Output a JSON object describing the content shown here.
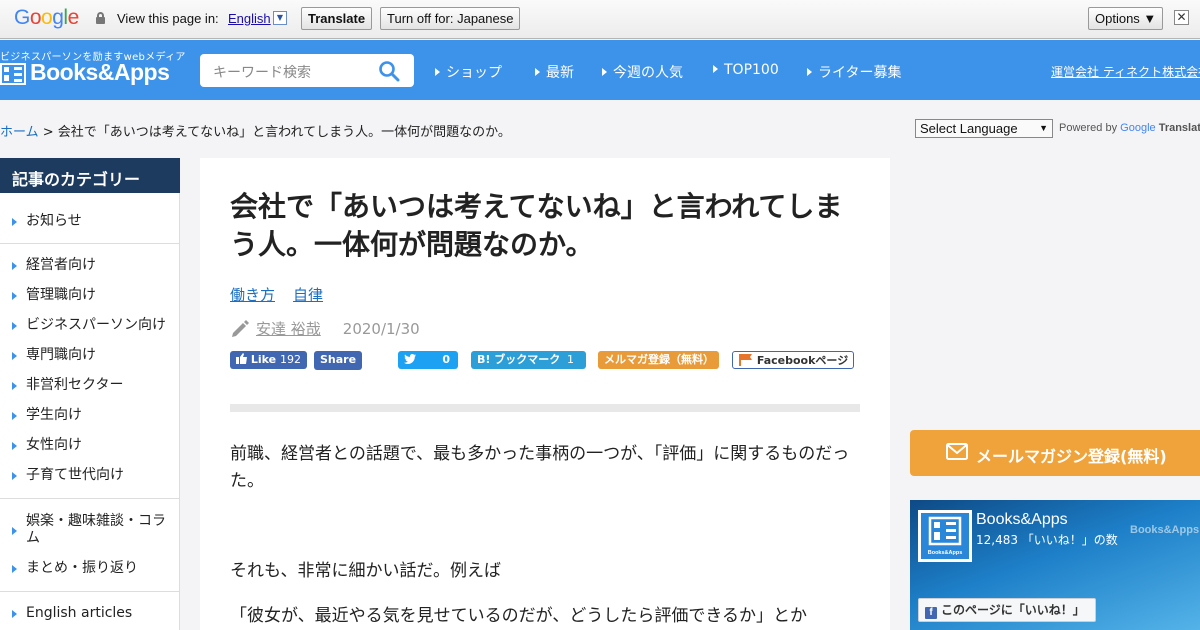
{
  "translate_bar": {
    "view_in_label": "View this page in:",
    "language": "English",
    "translate_button": "Translate",
    "turn_off_button": "Turn off for: Japanese",
    "options_button": "Options ▼",
    "close_glyph": "✕"
  },
  "header": {
    "tagline": "ビジネスパーソンを励ますwebメディア",
    "logo_text": "Books&Apps",
    "search_placeholder": "キーワード検索",
    "nav": [
      "ショップ",
      "最新",
      "今週の人気",
      "TOP100",
      "ライター募集"
    ],
    "company_link": "運営会社 ティネクト株式会社"
  },
  "breadcrumb": {
    "home": "ホーム",
    "separator": " > ",
    "current": "会社で「あいつは考えてないね」と言われてしまう人。一体何が問題なのか。"
  },
  "translate_widget": {
    "select_label": "Select Language",
    "powered_by": "Powered by",
    "google": "Google",
    "translate": "Translate"
  },
  "sidebar": {
    "heading": "記事のカテゴリー",
    "groups": [
      [
        "お知らせ"
      ],
      [
        "経営者向け",
        "管理職向け",
        "ビジネスパーソン向け",
        "専門職向け",
        "非営利セクター",
        "学生向け",
        "女性向け",
        "子育て世代向け"
      ],
      [
        "娯楽・趣味雑談・コラム",
        "まとめ・振り返り"
      ],
      [
        "English articles"
      ]
    ]
  },
  "article": {
    "title": "会社で「あいつは考えてないね」と言われてしまう人。一体何が問題なのか。",
    "tags": [
      "働き方",
      "自律"
    ],
    "author": "安達 裕哉",
    "date": "2020/1/30",
    "share": {
      "fb_like": "Like",
      "fb_like_count": "192",
      "fb_share": "Share",
      "tweet_count": "0",
      "hatena_label": "B! ブックマーク",
      "hatena_count": "1",
      "mailmag": "メルマガ登録（無料）",
      "fb_page": "Facebookページ"
    },
    "paragraphs": [
      "前職、経営者との話題で、最も多かった事柄の一つが、「評価」に関するものだった。",
      "それも、非常に細かい話だ。例えば",
      "「彼女が、最近やる気を見せているのだが、どうしたら評価できるか」とか"
    ]
  },
  "right": {
    "mail_button": "メールマガジン登録(無料)",
    "fb_widget": {
      "name": "Books&Apps",
      "likes": "12,483 「いいね！」の数",
      "watermark": "Books&Apps",
      "like_button": "このページに「いいね！」"
    }
  },
  "colors": {
    "header_bg": "#3d92ea",
    "sidebar_head_bg": "#1d3a5f",
    "link": "#1a6fc4",
    "mail_orange": "#f1a33b"
  }
}
